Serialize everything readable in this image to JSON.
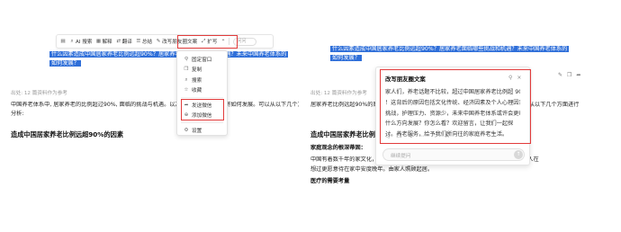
{
  "left": {
    "highlight_lines": [
      "什么因素造成中国居家养老比例远超90%？居家养老面临哪些挑战和机遇？未来中国养老体系的",
      "如何发展？"
    ],
    "meta": "出处: 12 篇资料作为参考",
    "body_lines": [
      "中国养老体系中, 居家养老的比例超过90%, 面临的挑战与机遇。以及未来中国养老体系将如何发展。可以从以下几个方面进行",
      "分析:"
    ],
    "heading": "造成中国居家养老比例远超90%的因素",
    "toolbar": {
      "items": [
        {
          "icon": "paste-icon",
          "label": ""
        },
        {
          "icon": "ai-icon",
          "label": "AI 搜索"
        },
        {
          "icon": "explain-icon",
          "label": "解释"
        },
        {
          "icon": "translate-icon",
          "label": "翻译"
        },
        {
          "icon": "summary-icon",
          "label": "总结"
        },
        {
          "icon": "rewrite-icon",
          "label": "改写朋友圈文案"
        },
        {
          "icon": "expand-icon",
          "label": "扩写"
        }
      ],
      "search_placeholder": "问问"
    },
    "menu": {
      "items": [
        {
          "icon": "pin-icon",
          "label": "固定窗口"
        },
        {
          "icon": "copy-icon",
          "label": "复制"
        },
        {
          "icon": "search-icon",
          "label": "搜索"
        },
        {
          "icon": "star-icon",
          "label": "收藏"
        },
        {
          "icon": "share-icon",
          "label": "发送微信"
        },
        {
          "icon": "add-icon",
          "label": "添加微信"
        },
        {
          "icon": "gear-icon",
          "label": "设置"
        }
      ]
    }
  },
  "right": {
    "highlight_lines": [
      "什么因素造成中国居家养老比例远超90%？居家养老面临哪些挑战和机遇？未来中国养老体系的",
      "如何发展？"
    ],
    "meta": "出处: 12 篇资料作为参考",
    "body_lines": [
      "居家养老比例远超90%的原因，面临的挑战与机遇，以及未来中国养老体系的发展，可以从以下几个方面进行"
    ],
    "heading": "造成中国居家养老比例远超90%",
    "subheading": "家庭观念的根深蒂固：",
    "body2_lines": [
      "中国有着数千年的家文化，孝道文化深入人心，多数老年人更倾向于在家养老，许多老年人在",
      "想过更愿意待在家中安度晚年。由家人照顾起居。"
    ],
    "heading2": "医疗的需要考量",
    "popup": {
      "title": "改写朋友圈文案",
      "lines": [
        "家人们，养老话题不比较，超过中国居家养老比例超 90%",
        "！这背后的原因包括文化传统、经济因素及个人心理因素。",
        "挑战，护理压力、资源少，未来中国养老体系或许会更综合化",
        "什么方向发展？你怎么看？欢迎留言，让我们一起探",
        "讨。养老服务，给予我们所向往的家庭养老生活。"
      ],
      "reply_placeholder": "继续提问"
    }
  }
}
